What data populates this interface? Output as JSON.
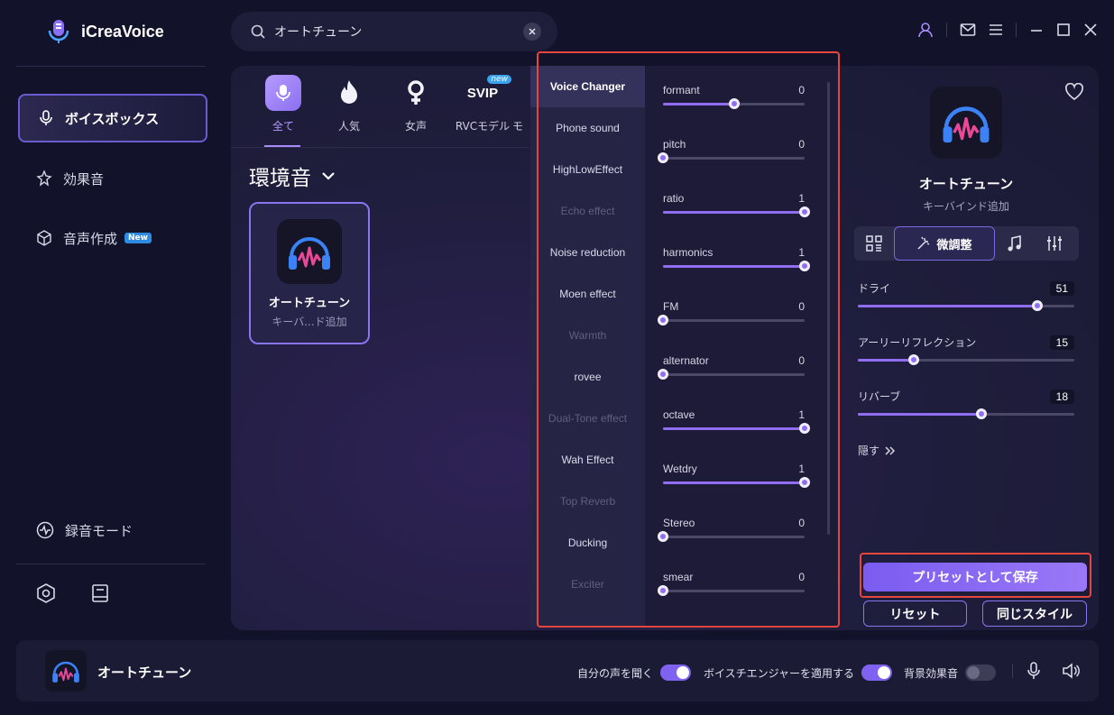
{
  "app": {
    "title": "iCreaVoice"
  },
  "sidebar": {
    "items": [
      {
        "label": "ボイスボックス"
      },
      {
        "label": "効果音"
      },
      {
        "label": "音声作成",
        "badge": "New"
      }
    ],
    "record_mode": "録音モード"
  },
  "search": {
    "value": "オートチューン",
    "placeholder": ""
  },
  "categories": [
    {
      "label": "全て"
    },
    {
      "label": "人気"
    },
    {
      "label": "女声"
    },
    {
      "label": "RVCモデル",
      "icon_text": "SVIP",
      "badge": "new"
    },
    {
      "label": "モ"
    }
  ],
  "section": {
    "title": "環境音"
  },
  "voice_card": {
    "name": "オートチューン",
    "subtitle": "キーバ...ド追加"
  },
  "effects": {
    "list": [
      {
        "label": "Voice Changer",
        "state": "selected"
      },
      {
        "label": "Phone sound",
        "state": "normal"
      },
      {
        "label": "HighLowEffect",
        "state": "normal"
      },
      {
        "label": "Echo effect",
        "state": "dim"
      },
      {
        "label": "Noise reduction",
        "state": "normal"
      },
      {
        "label": "Moen effect",
        "state": "normal"
      },
      {
        "label": "Warmth",
        "state": "dim"
      },
      {
        "label": "rovee",
        "state": "normal"
      },
      {
        "label": "Dual-Tone effect",
        "state": "dim"
      },
      {
        "label": "Wah Effect",
        "state": "normal"
      },
      {
        "label": "Top Reverb",
        "state": "dim"
      },
      {
        "label": "Ducking",
        "state": "normal"
      },
      {
        "label": "Exciter",
        "state": "dim"
      }
    ],
    "sliders": [
      {
        "label": "formant",
        "value": "0",
        "level": 0.5
      },
      {
        "label": "pitch",
        "value": "0",
        "level": 0
      },
      {
        "label": "ratio",
        "value": "1",
        "level": 1
      },
      {
        "label": "harmonics",
        "value": "1",
        "level": 1
      },
      {
        "label": "FM",
        "value": "0",
        "level": 0
      },
      {
        "label": "alternator",
        "value": "0",
        "level": 0
      },
      {
        "label": "octave",
        "value": "1",
        "level": 1
      },
      {
        "label": "Wetdry",
        "value": "1",
        "level": 1
      },
      {
        "label": "Stereo",
        "value": "0",
        "level": 0
      },
      {
        "label": "smear",
        "value": "0",
        "level": 0
      }
    ]
  },
  "detail": {
    "name": "オートチューン",
    "subtitle": "キーバインド追加",
    "active_tab": "微調整",
    "sliders": [
      {
        "label": "ドライ",
        "value": "51",
        "level": 0.83
      },
      {
        "label": "アーリーリフレクション",
        "value": "15",
        "level": 0.26
      },
      {
        "label": "リバーブ",
        "value": "18",
        "level": 0.57
      }
    ],
    "hide_label": "隠す",
    "save_preset": "プリセットとして保存",
    "reset": "リセット",
    "same_style": "同じスタイル"
  },
  "bottom": {
    "voice_name": "オートチューン",
    "options": [
      {
        "label": "自分の声を聞く",
        "on": true
      },
      {
        "label": "ボイスチエンジャーを適用する",
        "on": true
      },
      {
        "label": "背景効果音",
        "on": false
      }
    ]
  },
  "colors": {
    "accent": "#8f6ef2",
    "highlight": "#e8453c",
    "background": "#12122a"
  }
}
